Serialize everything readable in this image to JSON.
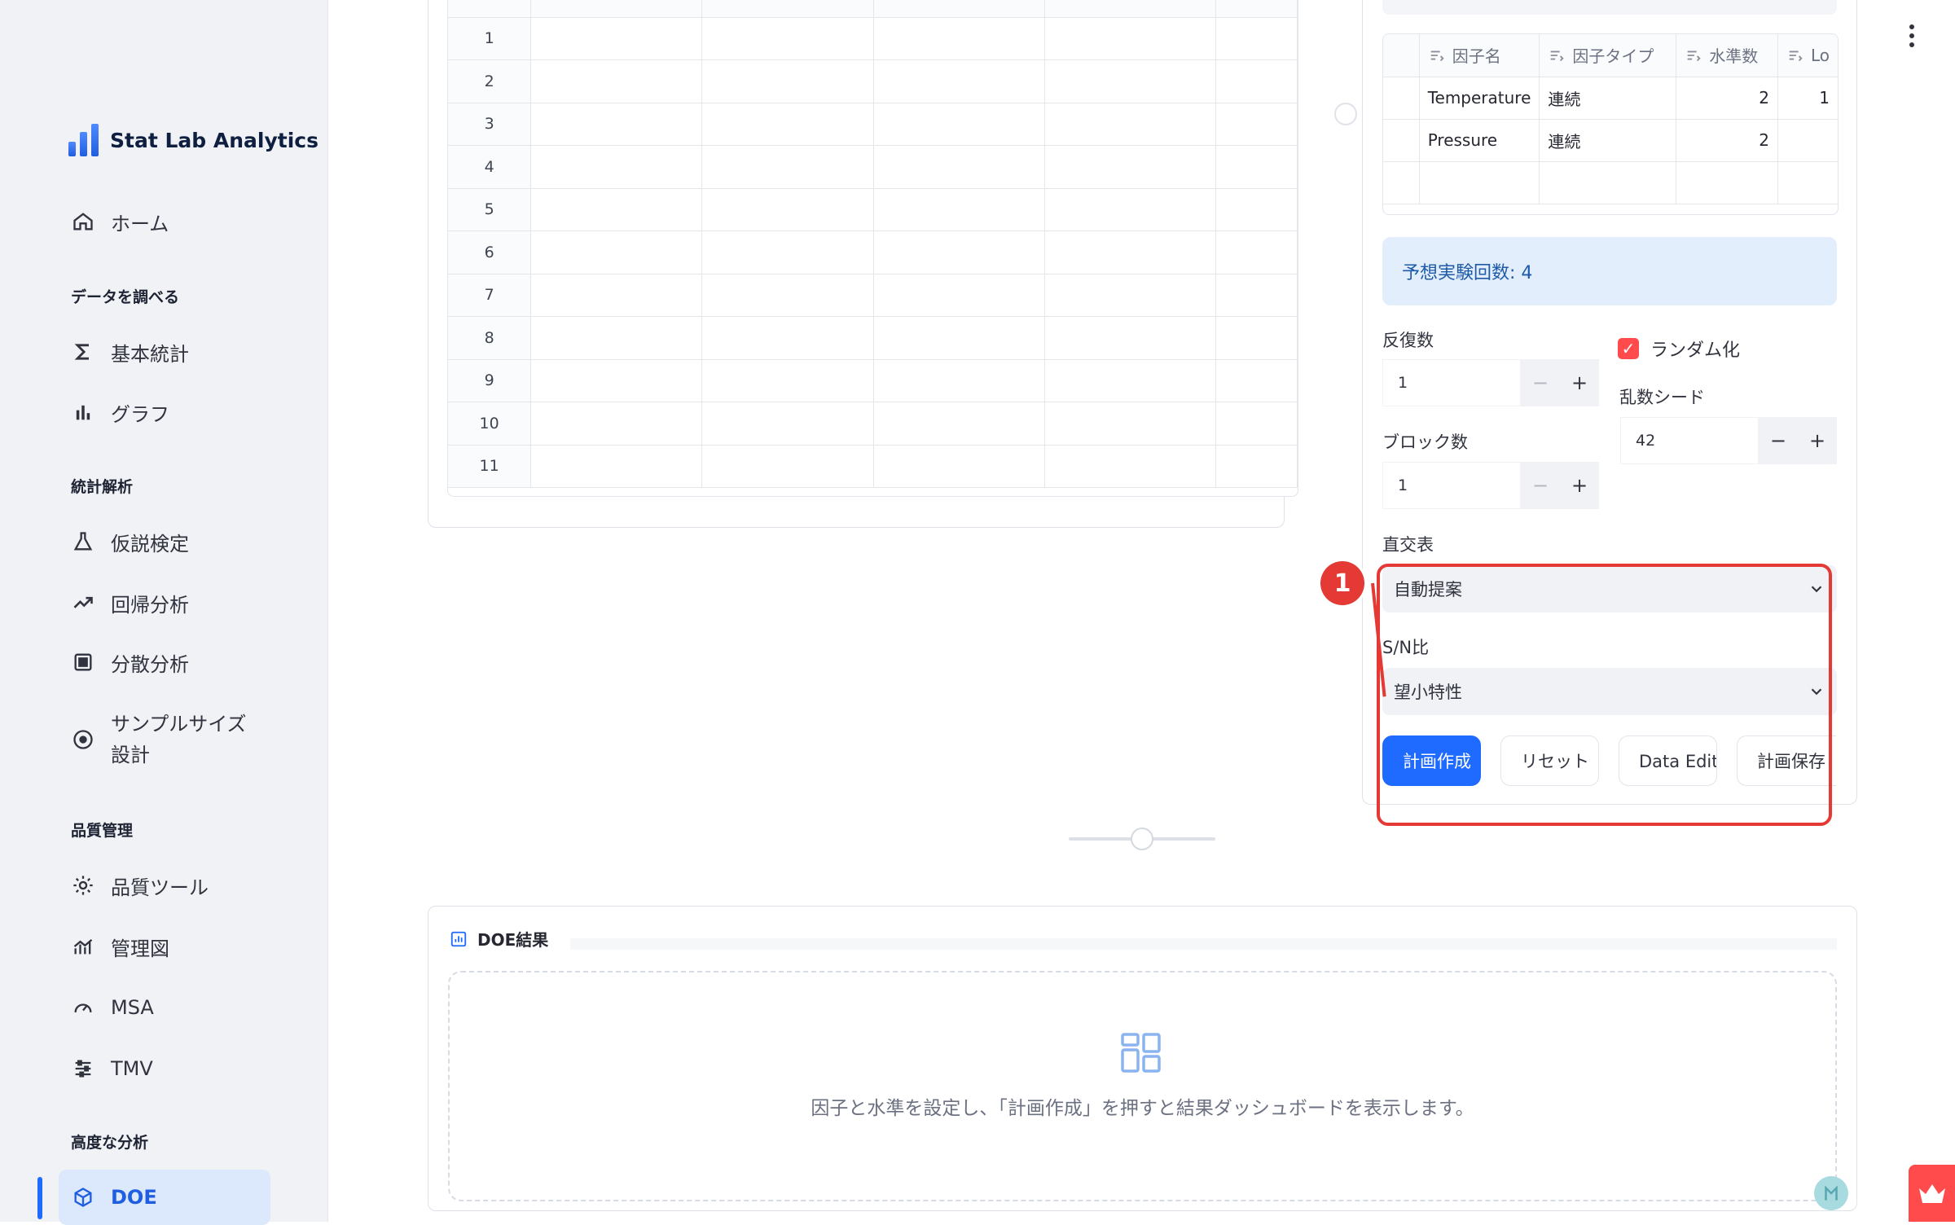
{
  "app": {
    "title": "Stat Lab Analytics"
  },
  "sidebar": {
    "home": "ホーム",
    "sections": [
      {
        "title": "データを調べる",
        "items": [
          "基本統計",
          "グラフ"
        ]
      },
      {
        "title": "統計解析",
        "items": [
          "仮説検定",
          "回帰分析",
          "分散分析",
          "サンプルサイズ設計"
        ]
      },
      {
        "title": "品質管理",
        "items": [
          "品質ツール",
          "管理図",
          "MSA",
          "TMV"
        ]
      },
      {
        "title": "高度な分析",
        "items": [
          "DOE"
        ]
      }
    ],
    "active_item": "DOE"
  },
  "data_grid": {
    "row_numbers": [
      "1",
      "2",
      "3",
      "4",
      "5",
      "6",
      "7",
      "8",
      "9",
      "10",
      "11"
    ]
  },
  "factor_table": {
    "columns": [
      "因子名",
      "因子タイプ",
      "水準数",
      "Lo"
    ],
    "rows": [
      {
        "name": "Temperature",
        "type": "連続",
        "levels": "2",
        "low": "1"
      },
      {
        "name": "Pressure",
        "type": "連続",
        "levels": "2",
        "low": ""
      }
    ]
  },
  "expected_runs": "予想実験回数: 4",
  "replicates": {
    "label": "反復数",
    "value": "1"
  },
  "blocks": {
    "label": "ブロック数",
    "value": "1"
  },
  "randomize": {
    "label": "ランダム化",
    "checked": true
  },
  "seed": {
    "label": "乱数シード",
    "value": "42"
  },
  "orthogonal": {
    "label": "直交表",
    "selected": "自動提案"
  },
  "sn_ratio": {
    "label": "S/N比",
    "selected": "望小特性"
  },
  "actions": {
    "create": "計画作成",
    "reset": "リセット",
    "data_editor": "Data Editorへ",
    "save": "計画保存"
  },
  "annotation": {
    "marker": "1",
    "color": "#e53935"
  },
  "results": {
    "title": "DOE結果",
    "empty_message": "因子と水準を設定し、「計画作成」を押すと結果ダッシュボードを表示します。"
  },
  "colors": {
    "accent": "#1f6bff",
    "danger": "#ff4b4b",
    "info_bg": "#e3eefc"
  }
}
